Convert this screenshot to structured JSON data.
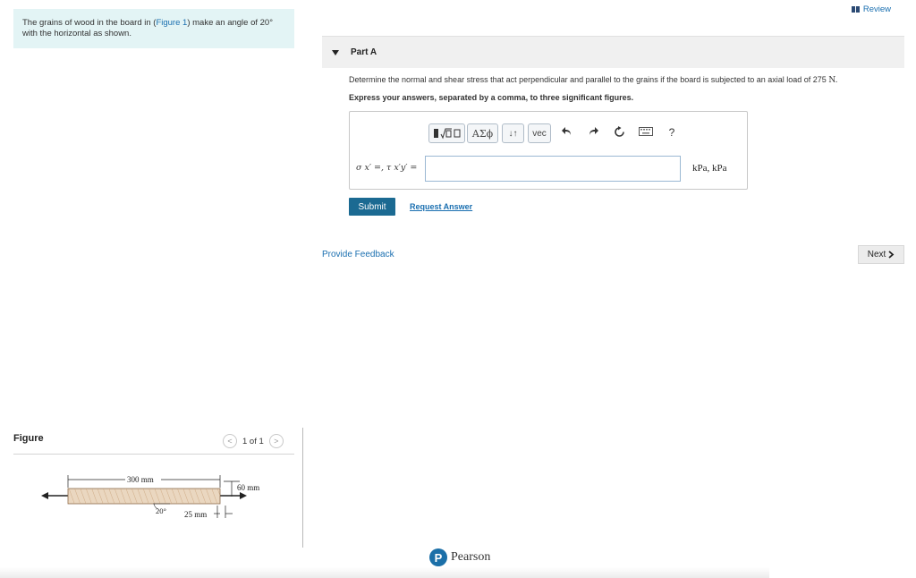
{
  "intro": {
    "text_before": "The grains of wood in the board in (",
    "link": "Figure 1",
    "text_after": ") make an angle of 20° with the horizontal as shown."
  },
  "header": {
    "review_label": "Review"
  },
  "part": {
    "title": "Part A",
    "question_text": "Determine the normal and shear stress that act perpendicular and parallel to the grains if the board is subjected to an axial load of 275",
    "question_unit": "N.",
    "instruction": "Express your answers, separated by a comma, to three significant figures."
  },
  "toolbar": {
    "templates_icon": "fraction-sqrt-template-icon",
    "greek_label": "ΑΣϕ",
    "arrows_label": "↓↑",
    "vec_label": "vec",
    "undo_icon": "undo-icon",
    "redo_icon": "redo-icon",
    "reset_icon": "reset-icon",
    "keyboard_icon": "keyboard-icon",
    "help_label": "?"
  },
  "answer": {
    "label": "σ x′ =, τ x′y′ =",
    "value": "",
    "units": "kPa, kPa"
  },
  "actions": {
    "submit_label": "Submit",
    "request_label": "Request Answer",
    "feedback_label": "Provide Feedback",
    "next_label": "Next"
  },
  "figure": {
    "title": "Figure",
    "pager": "1 of 1",
    "dim_length": "300 mm",
    "dim_height": "60 mm",
    "dim_thickness": "25 mm",
    "angle": "20°"
  },
  "footer": {
    "brand": "Pearson"
  },
  "colors": {
    "accent": "#1b6a92",
    "link": "#1a6fb0",
    "intro_bg": "#e3f4f5"
  }
}
